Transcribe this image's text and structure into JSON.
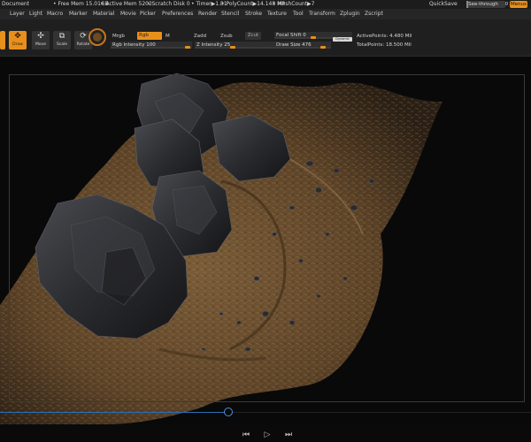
{
  "statusbar": {
    "document": "Document",
    "free_mem": "• Free Mem 15.01GB",
    "active_mem": "• Active Mem 5202",
    "scratch": "• Scratch Disk 0",
    "timer": "• Timer▶1.81",
    "polycount": "• PolyCount▶14.148 MP",
    "meshcount": "• MeshCount▶7",
    "quicksave": "QuickSave",
    "see_through_label": "See-through",
    "see_through_value": "0",
    "see_through_level": 0,
    "menus": "Menus"
  },
  "menubar": {
    "items": [
      "Layer",
      "Light",
      "Macro",
      "Marker",
      "Material",
      "Movie",
      "Picker",
      "Preferences",
      "Render",
      "Stencil",
      "Stroke",
      "Texture",
      "Tool",
      "Transform",
      "Zplugin",
      "Zscript"
    ]
  },
  "toolbar": {
    "tools": {
      "draw": "Draw",
      "move": "Move",
      "scale": "Scale",
      "rotate": "Rotate"
    },
    "mrgb": "Mrgb",
    "rgb": "Rgb",
    "m": "M",
    "zadd": "Zadd",
    "zsub": "Zsub",
    "zcut": "Zcut",
    "rgb_intensity": "Rgb Intensity 100",
    "rgb_intensity_value": 100,
    "z_intensity": "Z Intensity 25",
    "z_intensity_value": 25,
    "focal_shift": "Focal Shift 0",
    "focal_shift_value": 0,
    "draw_size": "Draw Size 476",
    "draw_size_value": 476,
    "lazy_mouse": "Dynamic",
    "active_points": "ActivePoints: 4.480 Mil",
    "total_points": "TotalPoints: 18.500 Mil"
  },
  "timeline": {
    "position": 0.43,
    "prev_icon": "previous-keyframe-icon",
    "play_icon": "play-icon",
    "next_icon": "next-keyframe-icon"
  },
  "colors": {
    "accent": "#e8901c",
    "timeline": "#2b6fb5",
    "rock": "#2c2d31",
    "terrain": "#6b4f30"
  }
}
